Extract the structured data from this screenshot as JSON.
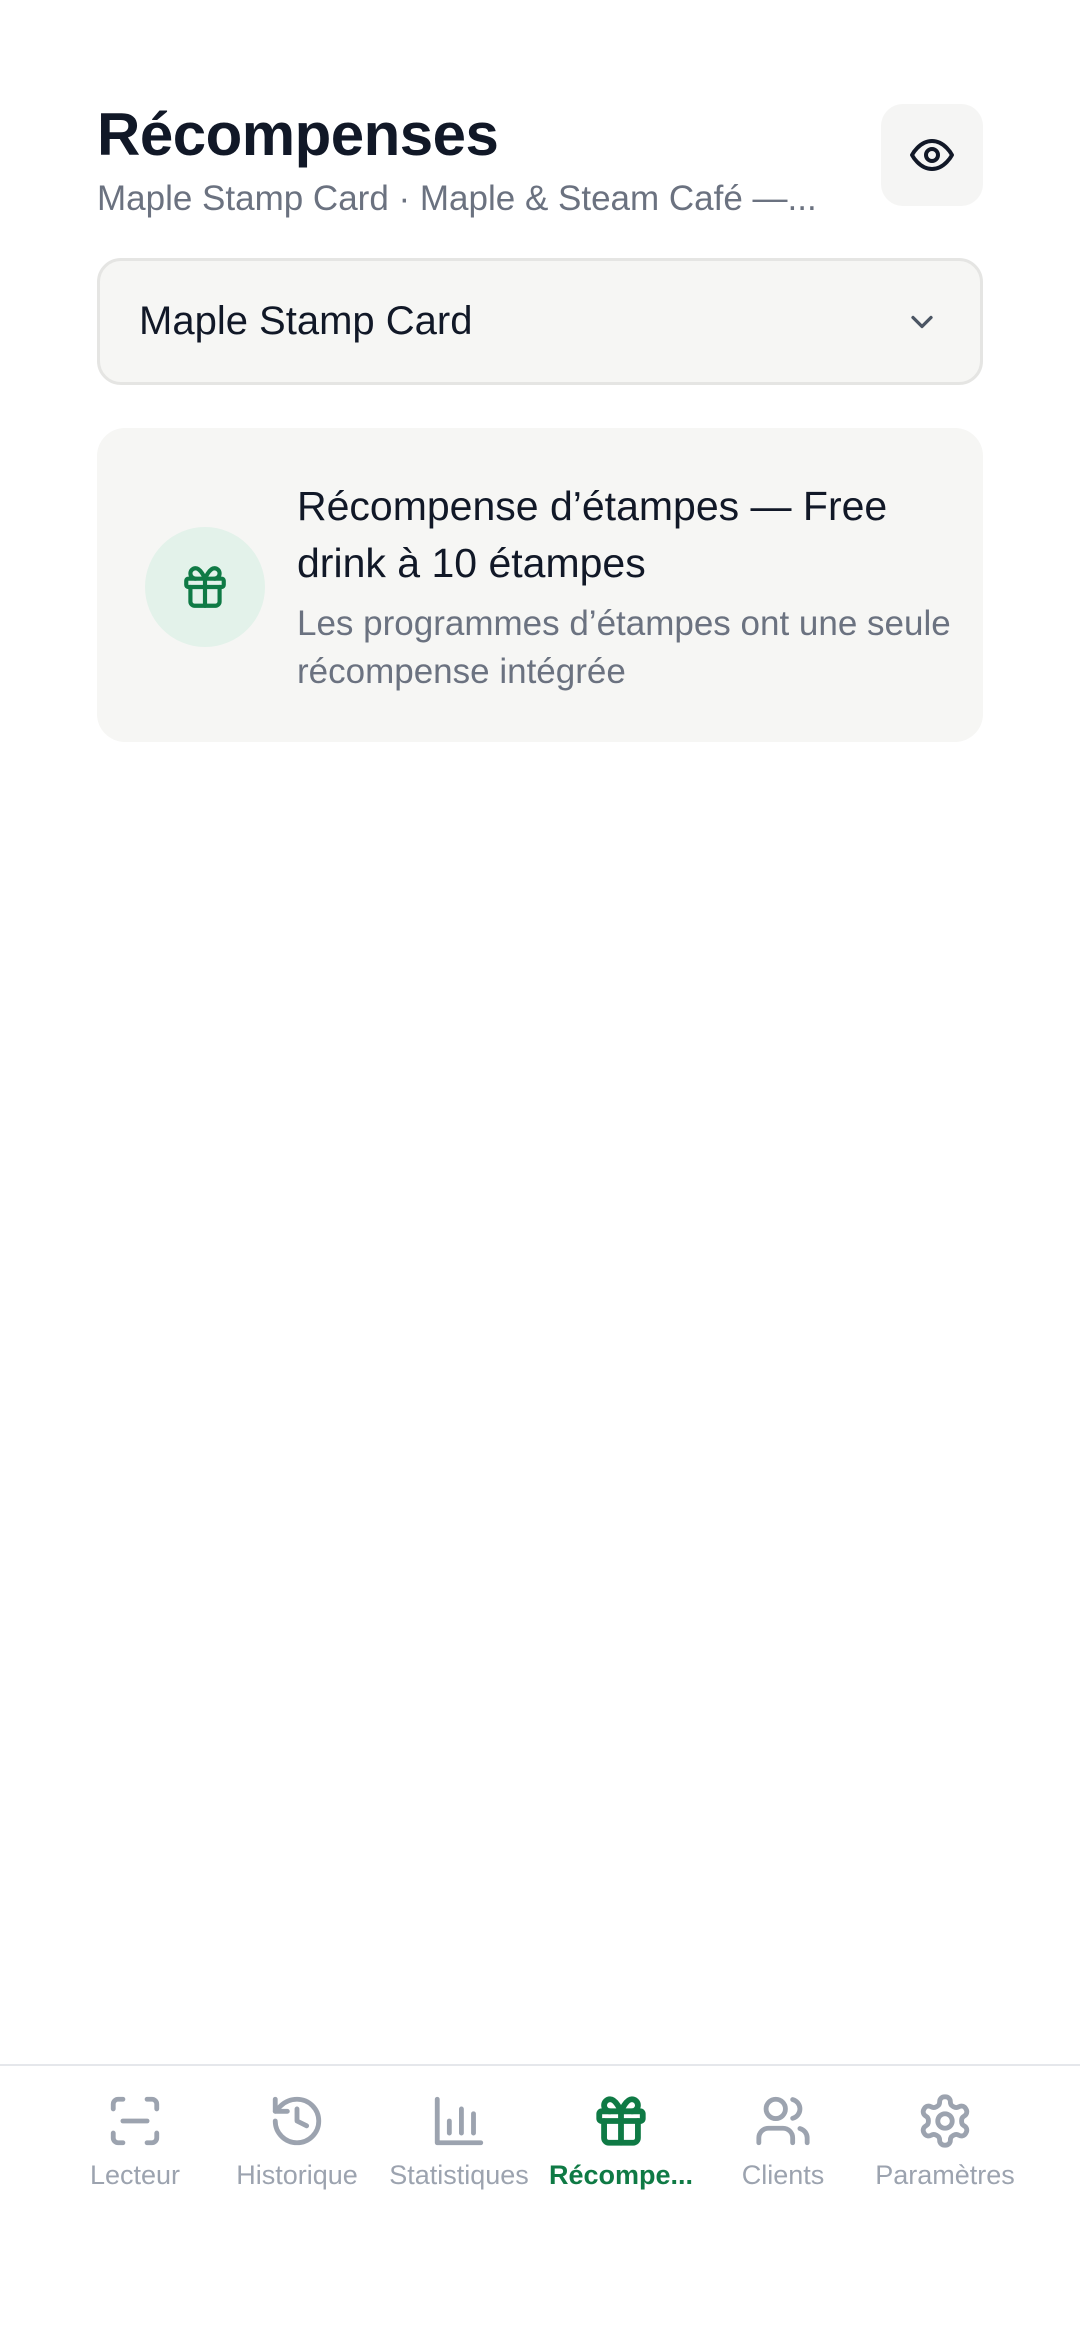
{
  "header": {
    "title": "Récompenses",
    "subtitle": "Maple Stamp Card · Maple & Steam Café —..."
  },
  "program_select": {
    "selected": "Maple Stamp Card"
  },
  "reward_card": {
    "title": "Récompense d’étampes — Free drink à 10 étampes",
    "description": "Les programmes d’étampes ont une seule récompense intégrée",
    "icon": "gift-icon"
  },
  "nav": {
    "items": [
      {
        "label": "Lecteur",
        "icon": "scan-icon",
        "active": false
      },
      {
        "label": "Historique",
        "icon": "history-icon",
        "active": false
      },
      {
        "label": "Statistiques",
        "icon": "bar-chart-icon",
        "active": false
      },
      {
        "label": "Récompe...",
        "icon": "gift-icon",
        "active": true
      },
      {
        "label": "Clients",
        "icon": "users-icon",
        "active": false
      },
      {
        "label": "Paramètres",
        "icon": "gear-icon",
        "active": false
      }
    ]
  },
  "colors": {
    "accent": "#0f7a45",
    "inactive": "#9ca3af",
    "text": "#111827",
    "muted": "#6b7280",
    "surface": "#f6f6f4"
  }
}
